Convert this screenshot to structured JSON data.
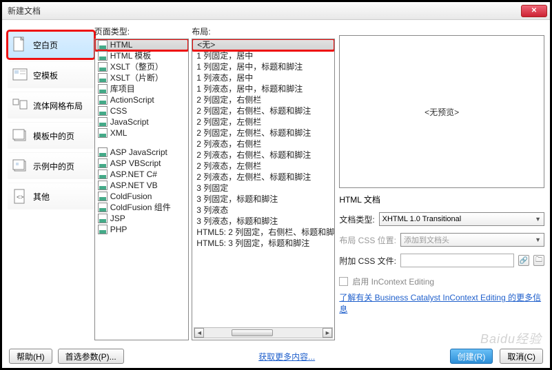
{
  "title": "新建文档",
  "sidebar": {
    "items": [
      {
        "label": "空白页",
        "selected": true
      },
      {
        "label": "空模板"
      },
      {
        "label": "流体网格布局"
      },
      {
        "label": "模板中的页"
      },
      {
        "label": "示例中的页"
      },
      {
        "label": "其他"
      }
    ]
  },
  "pagetype": {
    "header": "页面类型:",
    "items1": [
      "HTML",
      "HTML 模板",
      "XSLT（整页）",
      "XSLT（片断）",
      "库项目",
      "ActionScript",
      "CSS",
      "JavaScript",
      "XML"
    ],
    "items2": [
      "ASP JavaScript",
      "ASP VBScript",
      "ASP.NET C#",
      "ASP.NET VB",
      "ColdFusion",
      "ColdFusion 组件",
      "JSP",
      "PHP"
    ]
  },
  "layout": {
    "header": "布局:",
    "items": [
      "<无>",
      "1 列固定，居中",
      "1 列固定，居中，标题和脚注",
      "1 列液态，居中",
      "1 列液态，居中，标题和脚注",
      "2 列固定，右侧栏",
      "2 列固定，右侧栏、标题和脚注",
      "2 列固定，左侧栏",
      "2 列固定，左侧栏、标题和脚注",
      "2 列液态，右侧栏",
      "2 列液态，右侧栏、标题和脚注",
      "2 列液态，左侧栏",
      "2 列液态，左侧栏、标题和脚注",
      "3 列固定",
      "3 列固定，标题和脚注",
      "3 列液态",
      "3 列液态，标题和脚注",
      "HTML5: 2 列固定，右侧栏、标题和脚",
      "HTML5: 3 列固定，标题和脚注"
    ]
  },
  "preview": {
    "text": "<无预览>",
    "caption": "HTML 文档"
  },
  "form": {
    "doctype_label": "文档类型:",
    "doctype_value": "XHTML 1.0 Transitional",
    "csspos_label": "布局 CSS 位置:",
    "csspos_value": "添加到文档头",
    "attachcss_label": "附加 CSS 文件:",
    "attachcss_value": "",
    "enable_incontext": "启用 InContext Editing",
    "learn_link": "了解有关 Business Catalyst InContext Editing 的更多信息"
  },
  "footer": {
    "help": "帮助(H)",
    "prefs": "首选参数(P)...",
    "more": "获取更多内容...",
    "create": "创建(R)",
    "cancel": "取消(C)"
  },
  "watermark": "Baidu经验"
}
